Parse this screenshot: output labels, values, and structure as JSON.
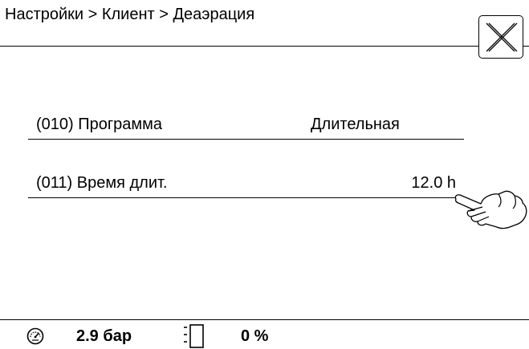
{
  "header": {
    "breadcrumb": "Настройки > Клиент > Деаэрация"
  },
  "settings": [
    {
      "label": "(010) Программа",
      "value": "Длительная"
    },
    {
      "label": "(011) Время длит.",
      "value": "12.0 h"
    }
  ],
  "status": {
    "pressure": "2.9 бар",
    "level": "0 %",
    "level_fraction": 0,
    "gauge_icon": "pressure-gauge-icon",
    "level_icon": "tank-level-icon"
  },
  "icons": {
    "close": "close-icon",
    "pointer": "hand-pointer-icon"
  }
}
